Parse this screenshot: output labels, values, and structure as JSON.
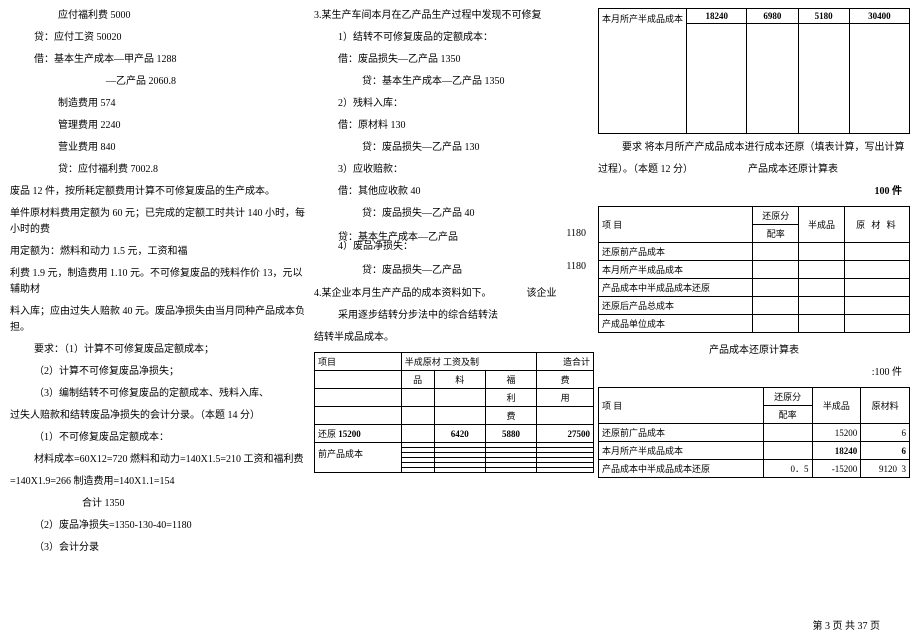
{
  "col1": {
    "l1": "应付福利费 5000",
    "l2": "贷：应付工资 50020",
    "l3": "借：基本生产成本—甲产品 1288",
    "l4": "—乙产品 2060.8",
    "l5": "制造费用 574",
    "l6": "管理费用 2240",
    "l7": "营业费用 840",
    "l8": "贷：应付福利费 7002.8",
    "p1": "废品 12 件，按所耗定额费用计算不可修复废品的生产成本。",
    "p2": "单件原材料费用定额为 60 元；已完成的定额工时共计 140 小时，每小时的费",
    "p3": "用定额为：燃料和动力 1.5 元，工资和福",
    "p4": "利费 1.9 元，制造费用 1.10 元。不可修复废品的残料作价 13，元以辅助材",
    "p5": "料入库；应由过失人赔款 40 元。废品净损失由当月同种产品成本负担。",
    "req_head": "要求：（1）计算不可修复废品定额成本；",
    "req2": "（2）计算不可修复废品净损失；",
    "req3": "（3）编制结转不可修复废品的定额成本、残料入库、",
    "p6": "过失人赔款和结转废品净损失的会计分录。（本题 14 分）",
    "ans1": "（1）不可修复废品定额成本：",
    "ans1a": "材料成本=60X12=720 燃料和动力=140X1.5=210 工资和福利费",
    "ans1b": "=140X1.9=266 制造费用=140X1.1=154",
    "ans1c": "合计 1350",
    "ans2": "（2）废品净损失=1350-130-40=1180",
    "ans3": "（3）会计分录"
  },
  "col2": {
    "h1": "3.某生产车间本月在乙产品生产过程中发现不可修复",
    "h1a": "1）结转不可修复废品的定额成本：",
    "l1": "借：废品损失—乙产品 1350",
    "l2": "贷：基本生产成本—乙产品 1350",
    "h2": "2）残料入库：",
    "l3": "借：原材料 130",
    "l4": "贷：废品损失—乙产品 130",
    "h3": "3）应收赔款：",
    "l5": "借：其他应收款 40",
    "l6": "贷：废品损失—乙产品 40",
    "l7b_1": "贷：基本生产成本—乙产品",
    "l7b_1v": "1180",
    "h4": "4）废品净损失：",
    "l7b_2": "贷：废品损失—乙产品",
    "l7b_2v": "1180",
    "q4a": "4.某企业本月生产产品的成本资料如下。",
    "q4b": "该企业",
    "q4c": "采用逐步结转分步法中的综合结转法",
    "q4d": "结转半成品成本。",
    "t_row_hdr": [
      "项目",
      "半成原材 工资及制",
      "造合计"
    ],
    "t_row_sub1": [
      "品",
      "料",
      "福",
      "费"
    ],
    "t_row_sub2": [
      "利",
      "用"
    ],
    "t_row_sub3": [
      "费"
    ],
    "t_row_data_label": "还原",
    "t_row_data": [
      "15200",
      "",
      "6420",
      "5880",
      "27500"
    ],
    "t_vert": "前产品成本"
  },
  "col3": {
    "top_table": {
      "row1": [
        "",
        "18240",
        "6980",
        "5180",
        "30400"
      ],
      "vert": "本月所产半成品成本"
    },
    "req_text1": "要求  将本月所产产成品成本进行成本还原（填表计算，写出计算",
    "req_text2": "过程）。（本题 12 分）",
    "tbl_title": "产品成本还原计算表",
    "unit": "100 件",
    "hdr": [
      "项  目",
      "还原分",
      "半成品",
      "原  材  料"
    ],
    "hdr_sub": "配率",
    "rows1": [
      "还原前产品成本",
      "本月所产半成品成本",
      "产品成本中半成品成本还原",
      "还原后产品总成本",
      "产成品单位成本"
    ],
    "tbl2_title": "产品成本还原计算表",
    "unit2": ":100 件",
    "hdr2": [
      "项  目",
      "还原分",
      "半成品",
      "原材料"
    ],
    "hdr2_sub": "配率",
    "rows2": [
      {
        "label": "还原前广品成本",
        "c2": "",
        "c3": "15200",
        "c4": "6"
      },
      {
        "label": "本月所产半成品成本",
        "c2": "",
        "c3": "18240",
        "c4": "6"
      },
      {
        "label": "产品成本中半成品成本还原",
        "c1": "0．5",
        "c2": "-15200",
        "c3": "9120",
        "c4": "3"
      }
    ]
  },
  "footer": "第 3 页 共 37 页"
}
